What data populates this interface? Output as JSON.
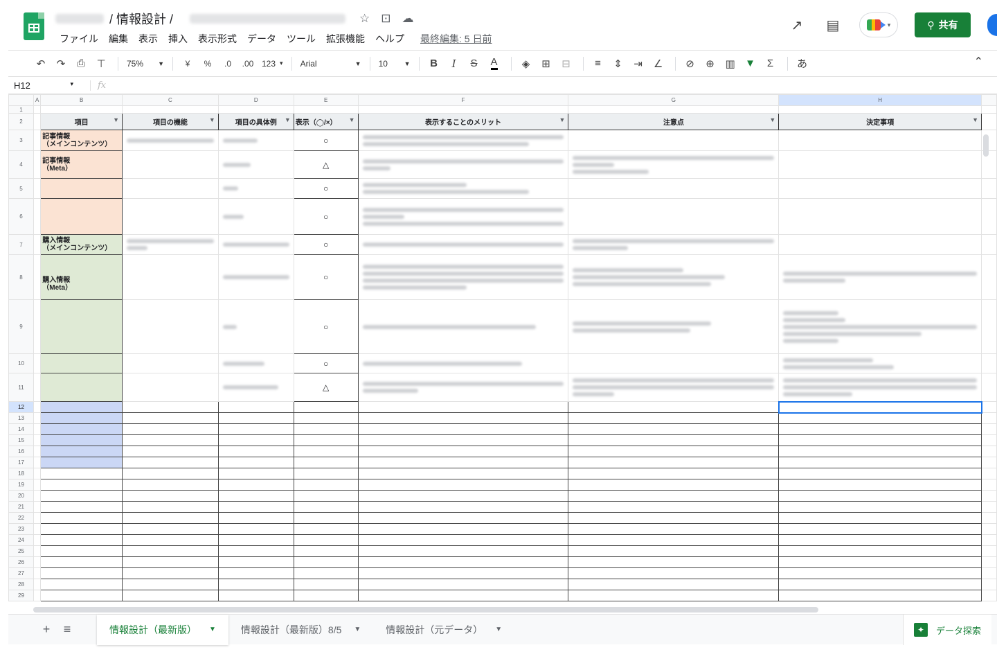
{
  "header": {
    "title": "/ 情報設計 /",
    "menu": [
      "ファイル",
      "編集",
      "表示",
      "挿入",
      "表示形式",
      "データ",
      "ツール",
      "拡張機能",
      "ヘルプ"
    ],
    "last_edit": "最終編集: 5 日前",
    "share_label": "共有"
  },
  "toolbar": {
    "zoom": "75%",
    "currency": "¥",
    "percent": "%",
    "dec_decrease": ".0",
    "dec_increase": ".00",
    "format_more": "123",
    "font": "Arial",
    "font_size": "10",
    "bold": "B",
    "italic": "I",
    "strike": "S",
    "text_color": "A",
    "sum": "Σ",
    "input_tools": "あ"
  },
  "formula_bar": {
    "cell_ref": "H12",
    "fx": "fx"
  },
  "sheet": {
    "columns": [
      "A",
      "B",
      "C",
      "D",
      "E",
      "F",
      "G",
      "H"
    ],
    "headers": [
      "項目",
      "項目の機能",
      "項目の具体例",
      "表示（◯/×）",
      "表示することのメリット",
      "注意点",
      "決定事項"
    ],
    "labels": {
      "r3": "記事情報\n（メインコンテンツ）",
      "r4": "記事情報\n（Meta）",
      "r7": "購入情報\n（メインコンテンツ）",
      "r8": "購入情報\n（Meta）"
    },
    "symbols": {
      "r3": "○",
      "r4": "△",
      "r5": "○",
      "r6": "○",
      "r7": "○",
      "r8": "○",
      "r9": "○",
      "r10": "○",
      "r11": "△"
    },
    "row_numbers": [
      "1",
      "2",
      "3",
      "4",
      "5",
      "6",
      "7",
      "8",
      "9",
      "10",
      "11",
      "12",
      "13",
      "14",
      "15",
      "16",
      "17",
      "18",
      "19",
      "20",
      "21",
      "22",
      "23",
      "24",
      "25",
      "26",
      "27",
      "28",
      "29"
    ]
  },
  "tabs": {
    "add": "+",
    "all_sheets": "≡",
    "items": [
      "情報設計（最新版）",
      "情報設計（最新版）8/5",
      "情報設計（元データ）"
    ],
    "explore": "データ探索"
  },
  "colors": {
    "brand_green": "#188038",
    "orange_fill": "#fbe3d3",
    "green_fill": "#dfead5",
    "blue_fill": "#cbd7f5",
    "selection": "#1a73e8"
  }
}
